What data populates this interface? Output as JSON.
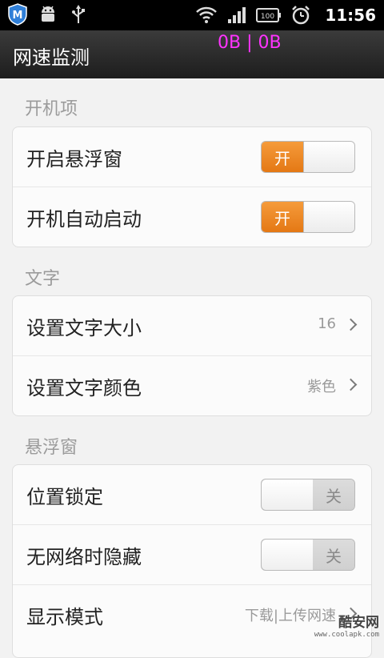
{
  "status_bar": {
    "icons_left": [
      "shield-app-icon",
      "android-debug-icon",
      "usb-icon"
    ],
    "icons_right": [
      "wifi-icon",
      "signal-icon",
      "battery-icon",
      "alarm-icon"
    ],
    "battery_text": "100",
    "time": "11:56"
  },
  "title_bar": {
    "title": "网速监测",
    "speed_overlay": "0B | 0B"
  },
  "sections": {
    "startup": {
      "label": "开机项",
      "items": [
        {
          "label": "开启悬浮窗",
          "toggle": "开"
        },
        {
          "label": "开机自动启动",
          "toggle": "开"
        }
      ]
    },
    "text": {
      "label": "文字",
      "items": [
        {
          "label": "设置文字大小",
          "value": "16"
        },
        {
          "label": "设置文字颜色",
          "value": "紫色"
        }
      ]
    },
    "float": {
      "label": "悬浮窗",
      "items": [
        {
          "label": "位置锁定",
          "toggle": "关"
        },
        {
          "label": "无网络时隐藏",
          "toggle": "关"
        },
        {
          "label": "显示模式",
          "value": "下载|上传网速"
        }
      ]
    }
  },
  "colors": {
    "accent": "#e47814",
    "overlay": "#ff33ff"
  },
  "watermark": {
    "main": "酷安网",
    "sub": "www.coolapk.com"
  }
}
